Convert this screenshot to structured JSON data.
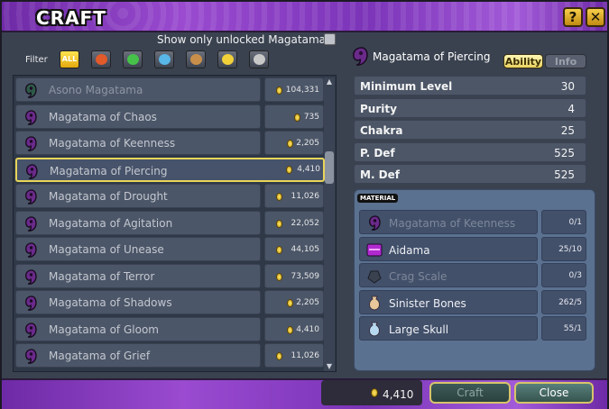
{
  "window": {
    "title": "CRAFT",
    "help_label": "?",
    "close_label": "✕"
  },
  "filter": {
    "label": "Filter",
    "show_unlocked_label": "Show only unlocked Magatama",
    "show_unlocked_checked": false,
    "buttons": [
      {
        "label": "ALL",
        "active": true,
        "icon": "all-text"
      },
      {
        "label": "",
        "active": false,
        "icon": "fire-icon",
        "color": "#e05a2a"
      },
      {
        "label": "",
        "active": false,
        "icon": "wind-icon",
        "color": "#46c24a"
      },
      {
        "label": "",
        "active": false,
        "icon": "water-icon",
        "color": "#58b6e8"
      },
      {
        "label": "",
        "active": false,
        "icon": "earth-icon",
        "color": "#c98f4a"
      },
      {
        "label": "",
        "active": false,
        "icon": "lightning-icon",
        "color": "#f1d03a"
      },
      {
        "label": "",
        "active": false,
        "icon": "neutral-icon",
        "color": "#c8c8c8"
      }
    ]
  },
  "list": {
    "items": [
      {
        "name": "Asono Magatama",
        "cost": "104,331",
        "gem_color": "#2d5a48",
        "dim": true
      },
      {
        "name": "Magatama of Chaos",
        "cost": "735",
        "gem_color": "#6a2a8a"
      },
      {
        "name": "Magatama of Keenness",
        "cost": "2,205",
        "gem_color": "#6a2a8a"
      },
      {
        "name": "Magatama of Piercing",
        "cost": "4,410",
        "gem_color": "#6a2a8a",
        "selected": true
      },
      {
        "name": "Magatama of Drought",
        "cost": "11,026",
        "gem_color": "#6a2a8a"
      },
      {
        "name": "Magatama of Agitation",
        "cost": "22,052",
        "gem_color": "#6a2a8a"
      },
      {
        "name": "Magatama of Unease",
        "cost": "44,105",
        "gem_color": "#6a2a8a"
      },
      {
        "name": "Magatama of Terror",
        "cost": "73,509",
        "gem_color": "#6a2a8a"
      },
      {
        "name": "Magatama of Shadows",
        "cost": "2,205",
        "gem_color": "#6a2a8a"
      },
      {
        "name": "Magatama of Gloom",
        "cost": "4,410",
        "gem_color": "#6a2a8a"
      },
      {
        "name": "Magatama of Grief",
        "cost": "11,026",
        "gem_color": "#6a2a8a"
      }
    ]
  },
  "detail": {
    "title": "Magatama of Piercing",
    "tabs": {
      "ability": "Ability",
      "info": "Info"
    },
    "stats": [
      {
        "label": "Minimum Level",
        "value": "30"
      },
      {
        "label": "Purity",
        "value": "4"
      },
      {
        "label": "Chakra",
        "value": "25"
      },
      {
        "label": "P. Def",
        "value": "525"
      },
      {
        "label": "M. Def",
        "value": "525"
      }
    ],
    "material_label": "MATERIAL",
    "materials": [
      {
        "name": "Magatama of Keenness",
        "count": "0/1",
        "icon": "magatama-icon",
        "color": "#6a2a8a",
        "dim": true
      },
      {
        "name": "Aidama",
        "count": "25/10",
        "icon": "aidama-icon",
        "color": "#b02ad0"
      },
      {
        "name": "Crag Scale",
        "count": "0/3",
        "icon": "scale-icon",
        "color": "#3a4250",
        "dim": true
      },
      {
        "name": "Sinister Bones",
        "count": "262/5",
        "icon": "bag-icon",
        "color": "#e8c89a"
      },
      {
        "name": "Large Skull",
        "count": "55/1",
        "icon": "bag-icon",
        "color": "#b7d9ef"
      }
    ]
  },
  "footer": {
    "total_cost": "4,410",
    "craft_label": "Craft",
    "close_label": "Close"
  }
}
